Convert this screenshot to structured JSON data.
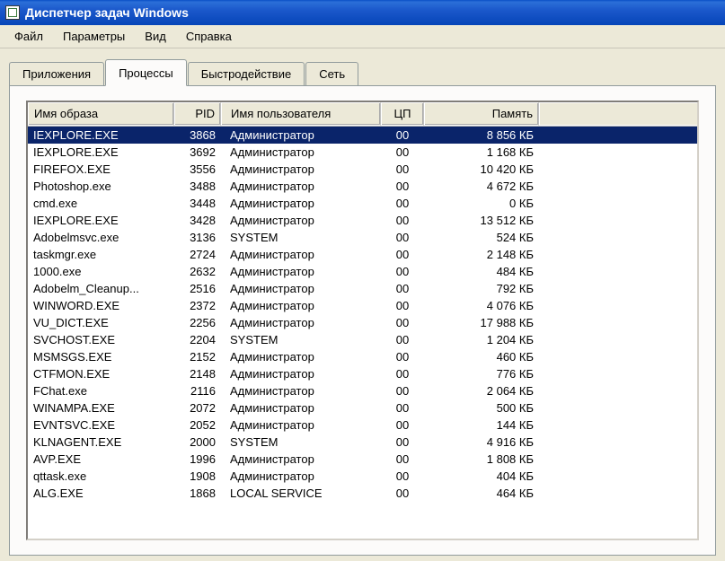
{
  "window": {
    "title": "Диспетчер задач Windows"
  },
  "menu": {
    "file": "Файл",
    "params": "Параметры",
    "view": "Вид",
    "help": "Справка"
  },
  "tabs": {
    "apps": "Приложения",
    "processes": "Процессы",
    "performance": "Быстродействие",
    "network": "Сеть"
  },
  "columns": {
    "name": "Имя образа",
    "pid": "PID",
    "user": "Имя пользователя",
    "cpu": "ЦП",
    "memory": "Память"
  },
  "processes": [
    {
      "name": "IEXPLORE.EXE",
      "pid": "3868",
      "user": "Администратор",
      "cpu": "00",
      "mem": "8 856 КБ",
      "selected": true
    },
    {
      "name": "IEXPLORE.EXE",
      "pid": "3692",
      "user": "Администратор",
      "cpu": "00",
      "mem": "1 168 КБ"
    },
    {
      "name": "FIREFOX.EXE",
      "pid": "3556",
      "user": "Администратор",
      "cpu": "00",
      "mem": "10 420 КБ"
    },
    {
      "name": "Photoshop.exe",
      "pid": "3488",
      "user": "Администратор",
      "cpu": "00",
      "mem": "4 672 КБ"
    },
    {
      "name": "cmd.exe",
      "pid": "3448",
      "user": "Администратор",
      "cpu": "00",
      "mem": "0 КБ"
    },
    {
      "name": "IEXPLORE.EXE",
      "pid": "3428",
      "user": "Администратор",
      "cpu": "00",
      "mem": "13 512 КБ"
    },
    {
      "name": "Adobelmsvc.exe",
      "pid": "3136",
      "user": "SYSTEM",
      "cpu": "00",
      "mem": "524 КБ"
    },
    {
      "name": "taskmgr.exe",
      "pid": "2724",
      "user": "Администратор",
      "cpu": "00",
      "mem": "2 148 КБ"
    },
    {
      "name": "1000.exe",
      "pid": "2632",
      "user": "Администратор",
      "cpu": "00",
      "mem": "484 КБ"
    },
    {
      "name": "Adobelm_Cleanup...",
      "pid": "2516",
      "user": "Администратор",
      "cpu": "00",
      "mem": "792 КБ"
    },
    {
      "name": "WINWORD.EXE",
      "pid": "2372",
      "user": "Администратор",
      "cpu": "00",
      "mem": "4 076 КБ"
    },
    {
      "name": "VU_DICT.EXE",
      "pid": "2256",
      "user": "Администратор",
      "cpu": "00",
      "mem": "17 988 КБ"
    },
    {
      "name": "SVCHOST.EXE",
      "pid": "2204",
      "user": "SYSTEM",
      "cpu": "00",
      "mem": "1 204 КБ"
    },
    {
      "name": "MSMSGS.EXE",
      "pid": "2152",
      "user": "Администратор",
      "cpu": "00",
      "mem": "460 КБ"
    },
    {
      "name": "CTFMON.EXE",
      "pid": "2148",
      "user": "Администратор",
      "cpu": "00",
      "mem": "776 КБ"
    },
    {
      "name": "FChat.exe",
      "pid": "2116",
      "user": "Администратор",
      "cpu": "00",
      "mem": "2 064 КБ"
    },
    {
      "name": "WINAMPA.EXE",
      "pid": "2072",
      "user": "Администратор",
      "cpu": "00",
      "mem": "500 КБ"
    },
    {
      "name": "EVNTSVC.EXE",
      "pid": "2052",
      "user": "Администратор",
      "cpu": "00",
      "mem": "144 КБ"
    },
    {
      "name": "KLNAGENT.EXE",
      "pid": "2000",
      "user": "SYSTEM",
      "cpu": "00",
      "mem": "4 916 КБ"
    },
    {
      "name": "AVP.EXE",
      "pid": "1996",
      "user": "Администратор",
      "cpu": "00",
      "mem": "1 808 КБ"
    },
    {
      "name": "qttask.exe",
      "pid": "1908",
      "user": "Администратор",
      "cpu": "00",
      "mem": "404 КБ"
    },
    {
      "name": "ALG.EXE",
      "pid": "1868",
      "user": "LOCAL SERVICE",
      "cpu": "00",
      "mem": "464 КБ"
    }
  ]
}
